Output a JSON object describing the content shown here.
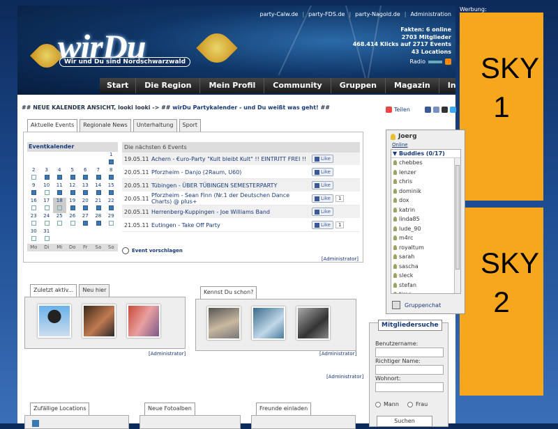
{
  "ad_label": "Werbung:",
  "sky1": "SKY 1",
  "sky2": "SKY 2",
  "header": {
    "logo": "wirDu",
    "slogan": "Wir und Du sind Nordschwarzwald",
    "toplinks": [
      "party-Calw.de",
      "party-FDS.de",
      "party-Nagold.de",
      "Administration"
    ],
    "facts": [
      "Fakten: 6 online",
      "2703 Mitglieder",
      "468.414 Klicks auf 2717 Events",
      "43 Locations"
    ],
    "radio": "Radio"
  },
  "nav": [
    "Start",
    "Die Region",
    "Mein Profil",
    "Community",
    "Gruppen",
    "Magazin",
    "Info"
  ],
  "notice": {
    "prefix": "## NEUE KALENDER ANSICHT, looki looki -> ## ",
    "link": "wirDu Partykalender - und Du weißt was geht!",
    "suffix": " ##"
  },
  "tabs": [
    "Aktuelle Events",
    "Regionale News",
    "Unterhaltung",
    "Sport"
  ],
  "calendar": {
    "title": "Eventkalender",
    "weekdays": [
      "Mo",
      "Di",
      "Mi",
      "Do",
      "Fr",
      "Sa",
      "So"
    ],
    "days": [
      "",
      "",
      "",
      "",
      "",
      "",
      "1",
      "2",
      "3",
      "4",
      "5",
      "6",
      "7",
      "8",
      "9",
      "10",
      "11",
      "12",
      "13",
      "14",
      "15",
      "16",
      "17",
      "18",
      "19",
      "20",
      "21",
      "22",
      "23",
      "24",
      "25",
      "26",
      "27",
      "28",
      "29",
      "30",
      "31",
      "",
      "",
      "",
      "",
      ""
    ]
  },
  "events": {
    "heading": "Die nächsten 6 Events",
    "like_label": "Like",
    "rows": [
      {
        "date": "19.05.11",
        "title": "Achern - €uro-Party \"Kult bleibt Kult\" !! EINTRITT FREI !!",
        "count": ""
      },
      {
        "date": "20.05.11",
        "title": "Pforzheim - Danjo (2Raum, U60)",
        "count": ""
      },
      {
        "date": "20.05.11",
        "title": "Tübingen - ÜBER TÜBINGEN SEMESTERPARTY",
        "count": ""
      },
      {
        "date": "20.05.11",
        "title": "Pforzheim - Sean Finn (Nr.1 der Deutschen Dance Charts) @ plus+",
        "count": "1"
      },
      {
        "date": "20.05.11",
        "title": "Herrenberg-Kuppingen - Joe Williams Band",
        "count": ""
      },
      {
        "date": "21.05.11",
        "title": "Eutingen - Take Off Party",
        "count": "1"
      }
    ],
    "suggest": "Event vorschlagen",
    "admin": "[Administrator]"
  },
  "recent": {
    "tabs": [
      "Zuletzt aktiv...",
      "Neu hier"
    ],
    "admin": "[Administrator]"
  },
  "know": {
    "title": "Kennst Du schon?",
    "admin": "[Administrator]"
  },
  "admin_mid": "[Administrator]",
  "bottom": [
    "Zufällige Locations",
    "Neue Fotoalben",
    "Freunde einladen"
  ],
  "sidebar": {
    "share": "Teilen",
    "user": "Joerg",
    "online": "Online",
    "buddies_title": "Buddies (0/17)",
    "buddies": [
      "chebbes",
      "lenzer",
      "chris",
      "dominik",
      "dox",
      "katrin",
      "linda85",
      "lude_90",
      "m4rc",
      "royaltum",
      "sarah",
      "sascha",
      "sleck",
      "stefan",
      "timo"
    ],
    "groupchat": "Gruppenchat",
    "search": {
      "title": "Mitgliedersuche",
      "user_label": "Benutzername:",
      "real_label": "Richtiger Name:",
      "city_label": "Wohnort:",
      "male": "Mann",
      "female": "Frau",
      "button": "Suchen"
    }
  }
}
